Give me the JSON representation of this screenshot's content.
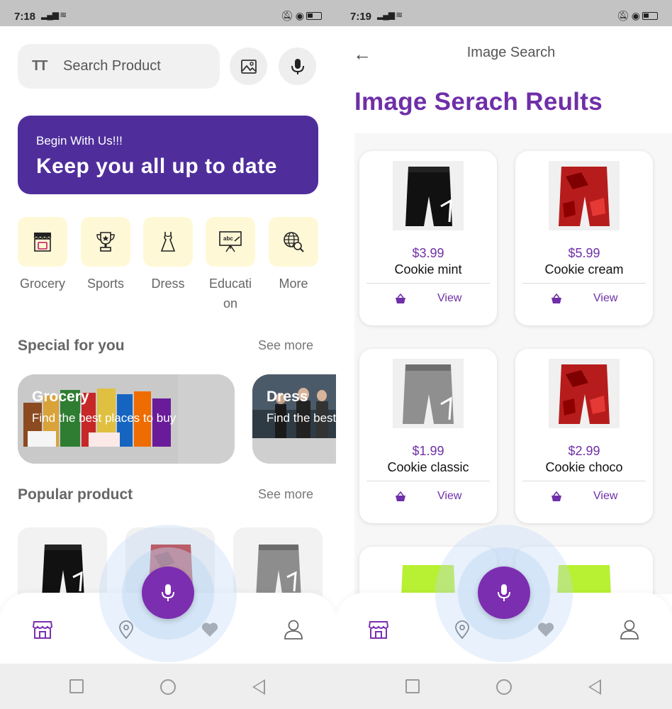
{
  "left_screen": {
    "status_bar": {
      "time": "7:18"
    },
    "search": {
      "placeholder": "Search Product"
    },
    "banner": {
      "subtitle": "Begin With Us!!!",
      "headline": "Keep you all up to date"
    },
    "categories": [
      {
        "label": "Grocery",
        "icon": "store-basket-icon"
      },
      {
        "label": "Sports",
        "icon": "trophy-icon"
      },
      {
        "label": "Dress",
        "icon": "dress-icon"
      },
      {
        "label": "Education",
        "icon": "presentation-board-icon"
      },
      {
        "label": "More",
        "icon": "globe-search-icon"
      }
    ],
    "special": {
      "title": "Special for you",
      "see_more": "See more",
      "cards": [
        {
          "title": "Grocery",
          "subtitle": "Find the best places to buy"
        },
        {
          "title": "Dress",
          "subtitle": "Find the best places to buy"
        }
      ]
    },
    "popular": {
      "title": "Popular product",
      "see_more": "See more"
    }
  },
  "right_screen": {
    "status_bar": {
      "time": "7:19"
    },
    "header": {
      "title": "Image Search"
    },
    "results_title": "Image Serach Reults",
    "results": [
      {
        "price": "$3.99",
        "name": "Cookie mint",
        "action": "View",
        "image": "black-shorts"
      },
      {
        "price": "$5.99",
        "name": "Cookie cream",
        "action": "View",
        "image": "red-camo-shorts"
      },
      {
        "price": "$1.99",
        "name": "Cookie classic",
        "action": "View",
        "image": "grey-shorts"
      },
      {
        "price": "$2.99",
        "name": "Cookie choco",
        "action": "View",
        "image": "red-camo-shorts"
      },
      {
        "price": "",
        "name": "",
        "action": "",
        "image": "lime-shorts"
      },
      {
        "price": "",
        "name": "",
        "action": "",
        "image": "lime-shorts"
      }
    ]
  },
  "colors": {
    "accent": "#6f2fa8",
    "banner": "#4f2e9c",
    "category_tile": "#fff8d6",
    "fab": "#7b2fb0"
  }
}
